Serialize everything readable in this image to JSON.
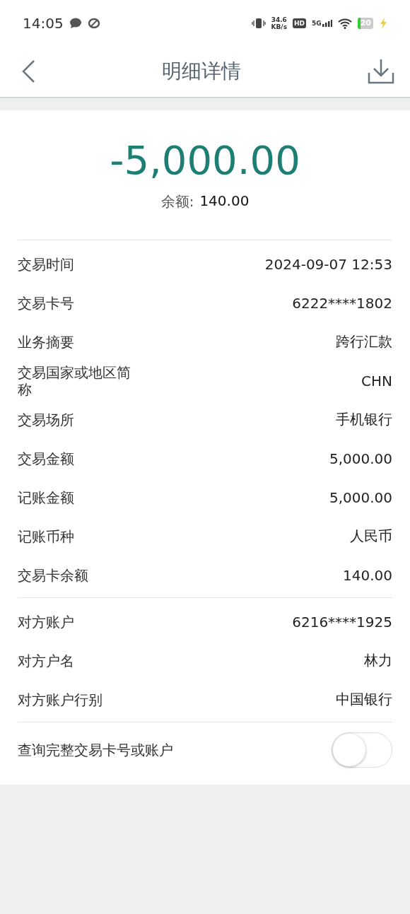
{
  "status_bar": {
    "time": "14:05",
    "speed_value": "34.6",
    "speed_unit": "KB/s",
    "hd": "HD",
    "network": "5G",
    "battery": "20"
  },
  "header": {
    "title": "明细详情"
  },
  "summary": {
    "amount": "-5,000.00",
    "balance_label": "余额:",
    "balance_value": "140.00"
  },
  "sections": [
    [
      {
        "label": "交易时间",
        "value": "2024-09-07 12:53"
      },
      {
        "label": "交易卡号",
        "value": "6222****1802"
      },
      {
        "label": "业务摘要",
        "value": "跨行汇款"
      },
      {
        "label": "交易国家或地区简称",
        "value": "CHN"
      },
      {
        "label": "交易场所",
        "value": "手机银行"
      },
      {
        "label": "交易金额",
        "value": "5,000.00"
      },
      {
        "label": "记账金额",
        "value": "5,000.00"
      },
      {
        "label": "记账币种",
        "value": "人民币"
      },
      {
        "label": "交易卡余额",
        "value": "140.00"
      }
    ],
    [
      {
        "label": "对方账户",
        "value": "6216****1925"
      },
      {
        "label": "对方户名",
        "value": "林力"
      },
      {
        "label": "对方账户行别",
        "value": "中国银行"
      }
    ]
  ],
  "toggle": {
    "label": "查询完整交易卡号或账户",
    "on": false
  }
}
